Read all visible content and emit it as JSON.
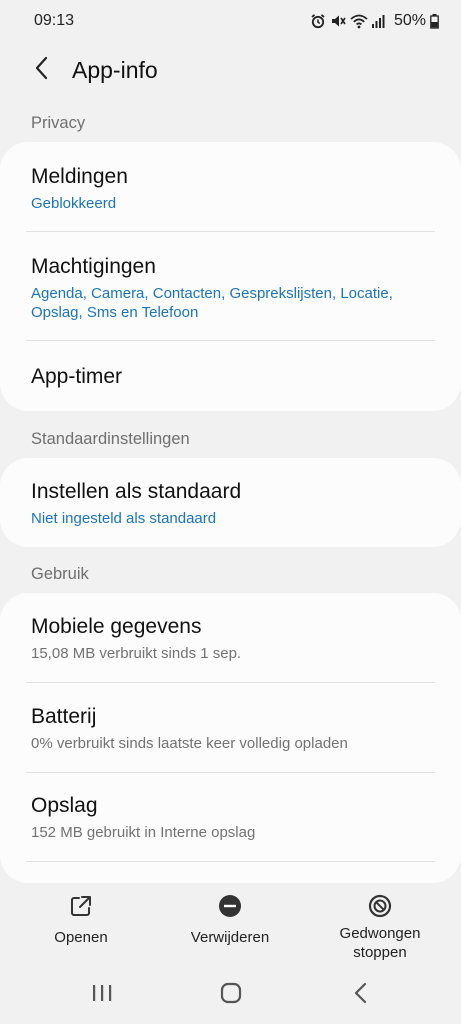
{
  "status": {
    "time": "09:13",
    "battery": "50%",
    "icons": [
      "alarm-icon",
      "mute-icon",
      "wifi-icon",
      "signal-icon",
      "battery-icon"
    ]
  },
  "header": {
    "title": "App-info",
    "back_icon": "chevron-left-icon"
  },
  "sections": {
    "privacy": {
      "title": "Privacy",
      "items": [
        {
          "title": "Meldingen",
          "subtitle": "Geblokkeerd"
        },
        {
          "title": "Machtigingen",
          "subtitle": "Agenda, Camera, Contacten, Gesprekslijsten, Locatie, Opslag, Sms en Telefoon"
        },
        {
          "title": "App-timer"
        }
      ]
    },
    "defaults": {
      "title": "Standaardinstellingen",
      "items": [
        {
          "title": "Instellen als standaard",
          "subtitle": "Niet ingesteld als standaard"
        }
      ]
    },
    "usage": {
      "title": "Gebruik",
      "items": [
        {
          "title": "Mobiele gegevens",
          "subtitle": "15,08 MB verbruikt sinds 1 sep."
        },
        {
          "title": "Batterij",
          "subtitle": "0% verbruikt sinds laatste keer volledig opladen"
        },
        {
          "title": "Opslag",
          "subtitle": "152 MB gebruikt in Interne opslag"
        }
      ]
    }
  },
  "actions": {
    "open": "Openen",
    "uninstall": "Verwijderen",
    "force_stop_line1": "Gedwongen",
    "force_stop_line2": "stoppen"
  },
  "colors": {
    "accent": "#1a74c0",
    "background": "#f1f1f1",
    "card": "#fcfcfc"
  }
}
